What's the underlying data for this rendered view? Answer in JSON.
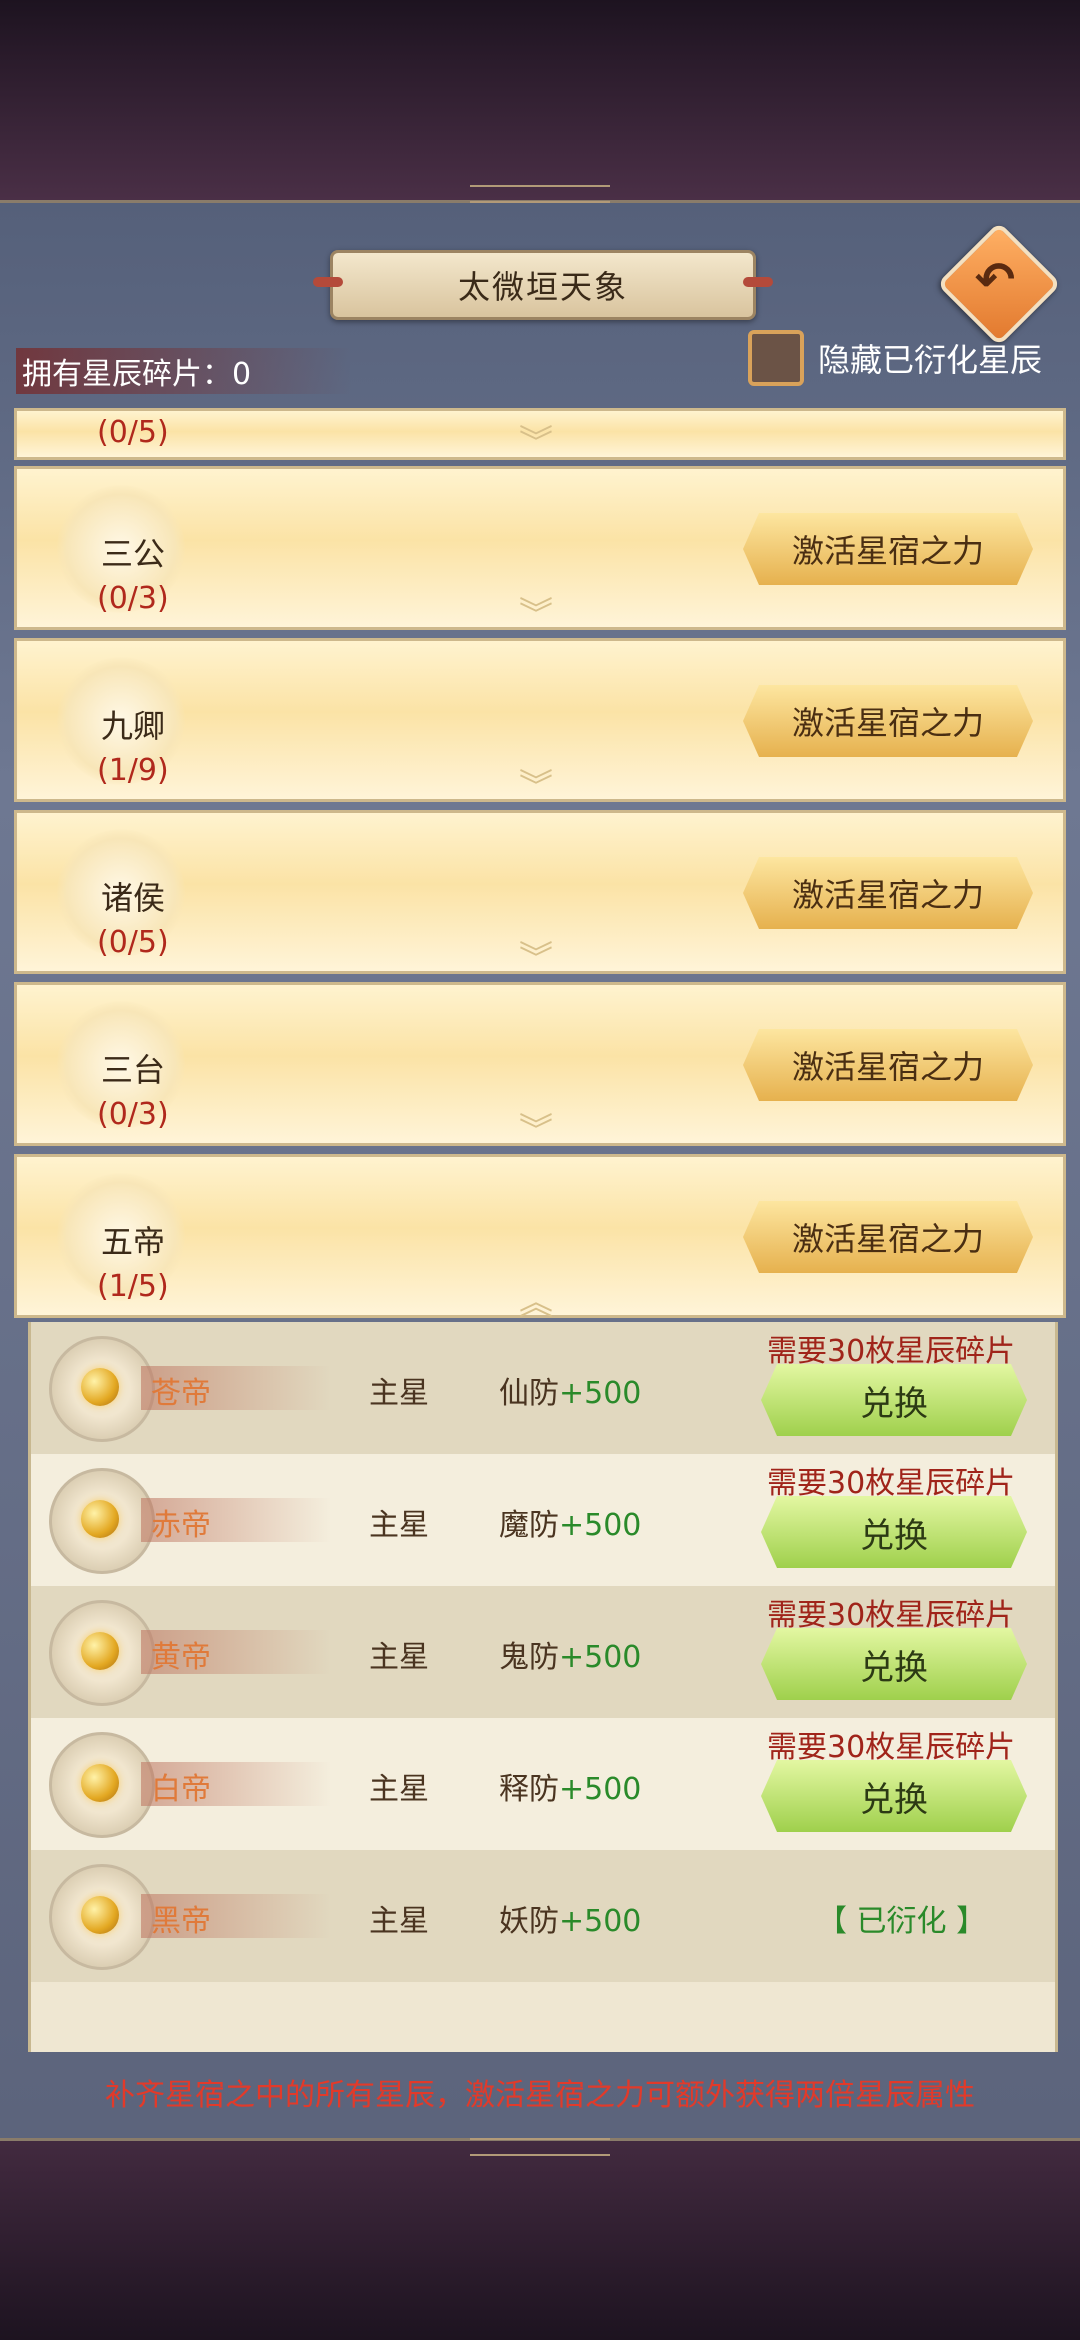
{
  "header": {
    "title": "太微垣天象",
    "back_icon": "back-arrow-icon"
  },
  "shards_label": "拥有星辰碎片：0",
  "hide_toggle": {
    "label": "隐藏已衍化星辰",
    "checked": false
  },
  "groups": [
    {
      "name": "",
      "count": "(0/5)",
      "expanded": false,
      "partial": true
    },
    {
      "name": "三公",
      "count": "(0/3)",
      "button": "激活星宿之力"
    },
    {
      "name": "九卿",
      "count": "(1/9)",
      "button": "激活星宿之力"
    },
    {
      "name": "诸侯",
      "count": "(0/5)",
      "button": "激活星宿之力"
    },
    {
      "name": "三台",
      "count": "(0/3)",
      "button": "激活星宿之力"
    },
    {
      "name": "五帝",
      "count": "(1/5)",
      "button": "激活星宿之力",
      "expanded": true
    }
  ],
  "stars": [
    {
      "name": "苍帝",
      "type": "主星",
      "attr": "仙防",
      "bonus": "+500",
      "need": "需要30枚星辰碎片",
      "button": "兑换"
    },
    {
      "name": "赤帝",
      "type": "主星",
      "attr": "魔防",
      "bonus": "+500",
      "need": "需要30枚星辰碎片",
      "button": "兑换"
    },
    {
      "name": "黄帝",
      "type": "主星",
      "attr": "鬼防",
      "bonus": "+500",
      "need": "需要30枚星辰碎片",
      "button": "兑换"
    },
    {
      "name": "白帝",
      "type": "主星",
      "attr": "释防",
      "bonus": "+500",
      "need": "需要30枚星辰碎片",
      "button": "兑换"
    },
    {
      "name": "黑帝",
      "type": "主星",
      "attr": "妖防",
      "bonus": "+500",
      "status": "【 已衍化 】"
    }
  ],
  "footer_note": "补齐星宿之中的所有星辰，激活星宿之力可额外获得两倍星辰属性",
  "colors": {
    "accent_red": "#b0281c",
    "bonus_green": "#2a8a2a",
    "panel_gold": "#fbe3a6"
  }
}
